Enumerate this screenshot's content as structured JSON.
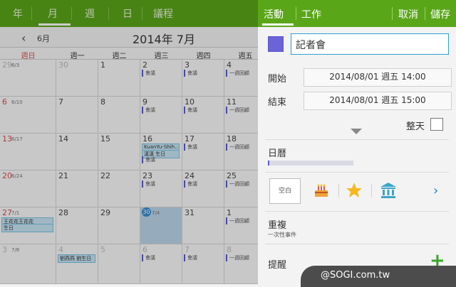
{
  "calendar": {
    "view_tabs": [
      "年",
      "月",
      "週",
      "日",
      "議程"
    ],
    "prev_month_label": "6月",
    "current_title": "2014年 7月",
    "weekdays": [
      "週日",
      "週一",
      "週二",
      "週三",
      "週四",
      "週五"
    ],
    "weeks": [
      [
        {
          "d": "29",
          "l": "6/3",
          "dim": true
        },
        {
          "d": "30",
          "dim": true
        },
        {
          "d": "1"
        },
        {
          "d": "2",
          "ev": [
            "會議"
          ]
        },
        {
          "d": "3",
          "ev": [
            "會議"
          ]
        },
        {
          "d": "4",
          "ev": [
            "一週回顧"
          ]
        }
      ],
      [
        {
          "d": "6",
          "l": "6/10"
        },
        {
          "d": "7"
        },
        {
          "d": "8"
        },
        {
          "d": "9",
          "ev": [
            "會議"
          ]
        },
        {
          "d": "10",
          "ev": [
            "會議"
          ]
        },
        {
          "d": "11",
          "ev": [
            "一週回顧"
          ]
        }
      ],
      [
        {
          "d": "13",
          "l": "6/17"
        },
        {
          "d": "14"
        },
        {
          "d": "15"
        },
        {
          "d": "16",
          "box": [
            "KuanYu-Shih..",
            "漢漢 生日"
          ],
          "ev": [
            "會議"
          ]
        },
        {
          "d": "17",
          "ev": [
            "會議"
          ]
        },
        {
          "d": "18",
          "ev": [
            "一週回顧"
          ]
        }
      ],
      [
        {
          "d": "20",
          "l": "6/24"
        },
        {
          "d": "21"
        },
        {
          "d": "22"
        },
        {
          "d": "23",
          "ev": [
            "會議"
          ]
        },
        {
          "d": "24",
          "ev": [
            "會議"
          ]
        },
        {
          "d": "25",
          "ev": [
            "一週回顧"
          ]
        }
      ],
      [
        {
          "d": "27",
          "l": "7/1",
          "box": [
            "王花花王花花",
            "生日"
          ]
        },
        {
          "d": "28"
        },
        {
          "d": "29"
        },
        {
          "d": "30",
          "l": "7/4",
          "sel": true
        },
        {
          "d": "31"
        },
        {
          "d": "1",
          "ev": [
            "一週回顧"
          ]
        }
      ],
      [
        {
          "d": "3",
          "l": "7/8",
          "dim": true
        },
        {
          "d": "4",
          "dim": true,
          "box": [
            "劉燕燕 劉生日"
          ]
        },
        {
          "d": "5",
          "dim": true
        },
        {
          "d": "6",
          "dim": true,
          "ev": [
            "會議"
          ]
        },
        {
          "d": "7",
          "dim": true,
          "ev": [
            "會議"
          ]
        },
        {
          "d": "8",
          "dim": true,
          "ev": [
            "一週回顧"
          ]
        }
      ]
    ]
  },
  "panel": {
    "tab_event": "活動",
    "tab_task": "工作",
    "cancel": "取消",
    "save": "儲存",
    "title_value": "記者會",
    "start_label": "開始",
    "start_value": "2014/08/01 週五  14:00",
    "end_label": "結束",
    "end_value": "2014/08/01 週五  15:00",
    "allday_label": "整天",
    "calendar_label": "日曆",
    "blank_sticker": "空白",
    "repeat_label": "重複",
    "repeat_value": "一次性事件",
    "reminder_label": "提醒",
    "add_reminder": "+",
    "event_color": "#6a64d8",
    "accent": "#5aa619"
  },
  "watermark": "@SOGI.com.tw"
}
